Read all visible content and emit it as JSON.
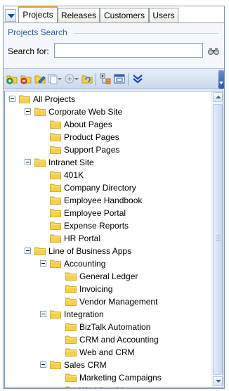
{
  "tabs": [
    {
      "label": "Projects",
      "active": true
    },
    {
      "label": "Releases",
      "active": false
    },
    {
      "label": "Customers",
      "active": false
    },
    {
      "label": "Users",
      "active": false
    }
  ],
  "search": {
    "group_title": "Projects Search",
    "label": "Search for:",
    "value": ""
  },
  "toolbar": {
    "buttons": [
      "add-project-icon",
      "add-folder-icon",
      "edit-icon",
      "copy-dropdown-icon",
      "move-dropdown-icon",
      "refresh-icon",
      "expand-all-icon",
      "collapse-icon",
      "chevron-double-down-icon"
    ]
  },
  "tree": {
    "nodes": [
      {
        "label": "All Projects",
        "level": 0,
        "expandable": true
      },
      {
        "label": "Corporate Web Site",
        "level": 1,
        "expandable": true
      },
      {
        "label": "About Pages",
        "level": 2,
        "expandable": false
      },
      {
        "label": "Product Pages",
        "level": 2,
        "expandable": false
      },
      {
        "label": "Support Pages",
        "level": 2,
        "expandable": false
      },
      {
        "label": "Intranet Site",
        "level": 1,
        "expandable": true
      },
      {
        "label": "401K",
        "level": 2,
        "expandable": false
      },
      {
        "label": "Company Directory",
        "level": 2,
        "expandable": false
      },
      {
        "label": "Employee Handbook",
        "level": 2,
        "expandable": false
      },
      {
        "label": "Employee Portal",
        "level": 2,
        "expandable": false
      },
      {
        "label": "Expense Reports",
        "level": 2,
        "expandable": false
      },
      {
        "label": "HR Portal",
        "level": 2,
        "expandable": false
      },
      {
        "label": "Line of Business Apps",
        "level": 1,
        "expandable": true
      },
      {
        "label": "Accounting",
        "level": 2,
        "expandable": true
      },
      {
        "label": "General Ledger",
        "level": 3,
        "expandable": false
      },
      {
        "label": "Invoicing",
        "level": 3,
        "expandable": false
      },
      {
        "label": "Vendor Management",
        "level": 3,
        "expandable": false
      },
      {
        "label": "Integration",
        "level": 2,
        "expandable": true
      },
      {
        "label": "BizTalk Automation",
        "level": 3,
        "expandable": false
      },
      {
        "label": "CRM and Accounting",
        "level": 3,
        "expandable": false
      },
      {
        "label": "Web and CRM",
        "level": 3,
        "expandable": false
      },
      {
        "label": "Sales CRM",
        "level": 2,
        "expandable": true
      },
      {
        "label": "Marketing Campaigns",
        "level": 3,
        "expandable": false
      },
      {
        "label": "Workflow Management",
        "level": 3,
        "expandable": false
      }
    ]
  },
  "colors": {
    "folder_fill": "#f5d04a",
    "folder_stroke": "#c79a1c",
    "accent": "#2f5fa8"
  }
}
